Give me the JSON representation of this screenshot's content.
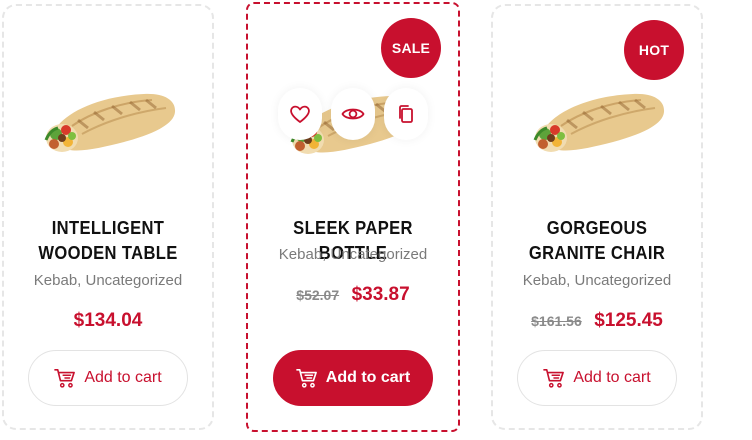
{
  "products": [
    {
      "title": "INTELLIGENT WOODEN TABLE",
      "categories": "Kebab, Uncategorized",
      "old_price": "",
      "price": "$134.04",
      "badge": "",
      "cart_label": "Add to cart"
    },
    {
      "title": "SLEEK PAPER BOTTLE",
      "categories": "Kebab, Uncategorized",
      "old_price": "$52.07",
      "price": "$33.87",
      "badge": "SALE",
      "cart_label": "Add to cart"
    },
    {
      "title": "GORGEOUS GRANITE CHAIR",
      "categories": "Kebab, Uncategorized",
      "old_price": "$161.56",
      "price": "$125.45",
      "badge": "HOT",
      "cart_label": "Add to cart"
    }
  ],
  "hover_actions": [
    "heart-icon",
    "eye-icon",
    "copy-icon"
  ],
  "colors": {
    "accent": "#c8102e",
    "muted_text": "#7a7a7a",
    "border": "#e6e6e6"
  }
}
